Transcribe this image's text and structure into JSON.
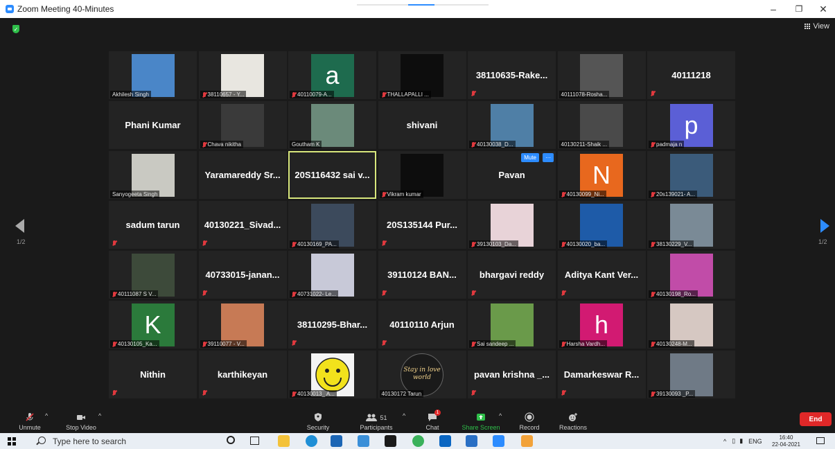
{
  "window": {
    "title": "Zoom Meeting 40-Minutes",
    "min": "–",
    "max": "❐",
    "close": "✕"
  },
  "view_label": "View",
  "pagination": {
    "left": "1/2",
    "right": "1/2"
  },
  "tiles": [
    {
      "type": "video",
      "label": "Akhilesh Singh",
      "muted": false,
      "color": "#4a86c8"
    },
    {
      "type": "video",
      "label": "38110657 - Y...",
      "muted": true,
      "color": "#e8e6e0"
    },
    {
      "type": "letter",
      "letter": "a",
      "bg": "#1e6b4e",
      "label": "40110079-A...",
      "muted": true
    },
    {
      "type": "video",
      "label": "THALLAPALLI ...",
      "muted": true,
      "color": "#0d0d0d"
    },
    {
      "type": "name",
      "name": "38110635-Rake...",
      "muted": true
    },
    {
      "type": "video",
      "label": "40111078-Rosha...",
      "muted": false,
      "color": "#555555"
    },
    {
      "type": "name",
      "name": "40111218",
      "muted": true
    },
    {
      "type": "name",
      "name": "Phani Kumar",
      "muted": false
    },
    {
      "type": "video",
      "label": "Chava nikitha",
      "muted": true,
      "color": "#3a3a3a"
    },
    {
      "type": "video",
      "label": "Goutham K",
      "muted": false,
      "color": "#6b8a7a"
    },
    {
      "type": "name",
      "name": "shivani",
      "muted": false
    },
    {
      "type": "video",
      "label": "40130038_D...",
      "muted": true,
      "color": "#4f7fa6"
    },
    {
      "type": "video",
      "label": "40130211-Shaik ...",
      "muted": false,
      "color": "#4a4a4a"
    },
    {
      "type": "letter",
      "letter": "p",
      "bg": "#5b5fd6",
      "label": "padmaja n",
      "muted": true
    },
    {
      "type": "video",
      "label": "Sanyogeeta Singh",
      "muted": false,
      "color": "#c9c9c2"
    },
    {
      "type": "name",
      "name": "Yaramareddy Sr...",
      "muted": false
    },
    {
      "type": "name",
      "name": "20S116432 sai v...",
      "muted": false,
      "active": true
    },
    {
      "type": "video",
      "label": "Vikram kumar",
      "muted": true,
      "color": "#0d0d0d"
    },
    {
      "type": "name",
      "name": "Pavan",
      "muted": false,
      "hover": true,
      "mute_btn": "Mute",
      "more_btn": "···"
    },
    {
      "type": "letter",
      "letter": "N",
      "bg": "#e8681e",
      "label": "40130099_Ni...",
      "muted": true
    },
    {
      "type": "video",
      "label": "20s139021- A...",
      "muted": true,
      "color": "#3b5b7a"
    },
    {
      "type": "name",
      "name": "sadum tarun",
      "muted": true
    },
    {
      "type": "name",
      "name": "40130221_Sivad...",
      "muted": true
    },
    {
      "type": "video",
      "label": "40130169_PA...",
      "muted": true,
      "color": "#3c4a5c"
    },
    {
      "type": "name",
      "name": "20S135144 Pur...",
      "muted": true
    },
    {
      "type": "video",
      "label": "39130103_Da...",
      "muted": true,
      "color": "#e8d3d8"
    },
    {
      "type": "video",
      "label": "40130020_ba...",
      "muted": true,
      "color": "#1e5ba8"
    },
    {
      "type": "video",
      "label": "38130229_V...",
      "muted": true,
      "color": "#7a8a96"
    },
    {
      "type": "video",
      "label": "40111087 S V...",
      "muted": true,
      "color": "#3d4a3a"
    },
    {
      "type": "name",
      "name": "40733015-janan...",
      "muted": true
    },
    {
      "type": "video",
      "label": "40731022- Le...",
      "muted": true,
      "color": "#c8c9d8"
    },
    {
      "type": "name",
      "name": "39110124 BAN...",
      "muted": true
    },
    {
      "type": "name",
      "name": "bhargavi reddy",
      "muted": true
    },
    {
      "type": "name",
      "name": "Aditya Kant Ver...",
      "muted": true
    },
    {
      "type": "video",
      "label": "40130198_Ro...",
      "muted": true,
      "color": "#c14ca8"
    },
    {
      "type": "letter",
      "letter": "K",
      "bg": "#2b7a3b",
      "label": "40130105_Ka...",
      "muted": true
    },
    {
      "type": "video",
      "label": "39110077 - V...",
      "muted": true,
      "color": "#c77a55"
    },
    {
      "type": "name",
      "name": "38110295-Bhar...",
      "muted": true
    },
    {
      "type": "name",
      "name": "40110110 Arjun",
      "muted": true
    },
    {
      "type": "video",
      "label": "Sai sandeep ...",
      "muted": true,
      "color": "#6a9a4a"
    },
    {
      "type": "letter",
      "letter": "h",
      "bg": "#d21a72",
      "label": "Harsha Vardh...",
      "muted": true
    },
    {
      "type": "video",
      "label": "40130248-M...",
      "muted": true,
      "color": "#d6c8c2"
    },
    {
      "type": "name",
      "name": "Nithin",
      "muted": true
    },
    {
      "type": "name",
      "name": "karthikeyan",
      "muted": true
    },
    {
      "type": "video",
      "label": "40130013_ A...",
      "muted": true,
      "color": "#f4f4f4",
      "smiley": true
    },
    {
      "type": "video",
      "label": "40130172 Tarun",
      "muted": false,
      "color": "#1a1a1a",
      "script": "Stay in love world"
    },
    {
      "type": "name",
      "name": "pavan krishna _...",
      "muted": true
    },
    {
      "type": "name",
      "name": "Damarkeswar R...",
      "muted": true
    },
    {
      "type": "video",
      "label": "39130093 _P...",
      "muted": true,
      "color": "#6f7a86"
    }
  ],
  "toolbar": {
    "unmute": "Unmute",
    "stop_video": "Stop Video",
    "security": "Security",
    "participants": "Participants",
    "participants_count": "51",
    "chat": "Chat",
    "chat_badge": "1",
    "share_screen": "Share Screen",
    "record": "Record",
    "reactions": "Reactions",
    "end": "End"
  },
  "taskbar": {
    "search_placeholder": "Type here to search",
    "lang": "ENG",
    "time": "16:40",
    "date": "22-04-2021"
  },
  "colors": {
    "accent": "#2d8cff",
    "end": "#e02828",
    "share": "#2fbf4a",
    "active_border": "#d8e77c"
  }
}
